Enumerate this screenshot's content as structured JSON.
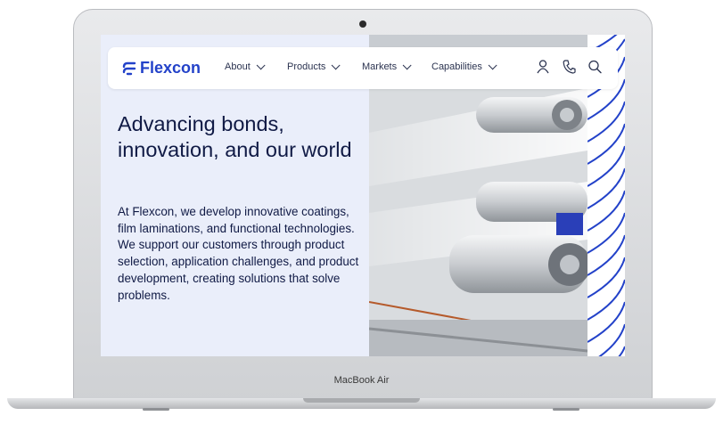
{
  "device": {
    "label": "MacBook Air"
  },
  "site": {
    "brand": "Flexcon",
    "nav": {
      "items": [
        {
          "label": "About"
        },
        {
          "label": "Products"
        },
        {
          "label": "Markets"
        },
        {
          "label": "Capabilities"
        }
      ],
      "icons": [
        "user-icon",
        "phone-icon",
        "search-icon"
      ]
    },
    "hero": {
      "headline": "Advancing bonds, innovation, and our world",
      "body": "At Flexcon, we develop innovative coatings, film laminations, and functional technologies. We support our customers through product selection, application challenges, and product development, creating solutions that solve problems.",
      "image": "film-lamination-rollers-photo"
    }
  },
  "colors": {
    "brand_blue": "#2342c9",
    "text_navy": "#101a45",
    "hero_bg": "#eaeefa"
  }
}
